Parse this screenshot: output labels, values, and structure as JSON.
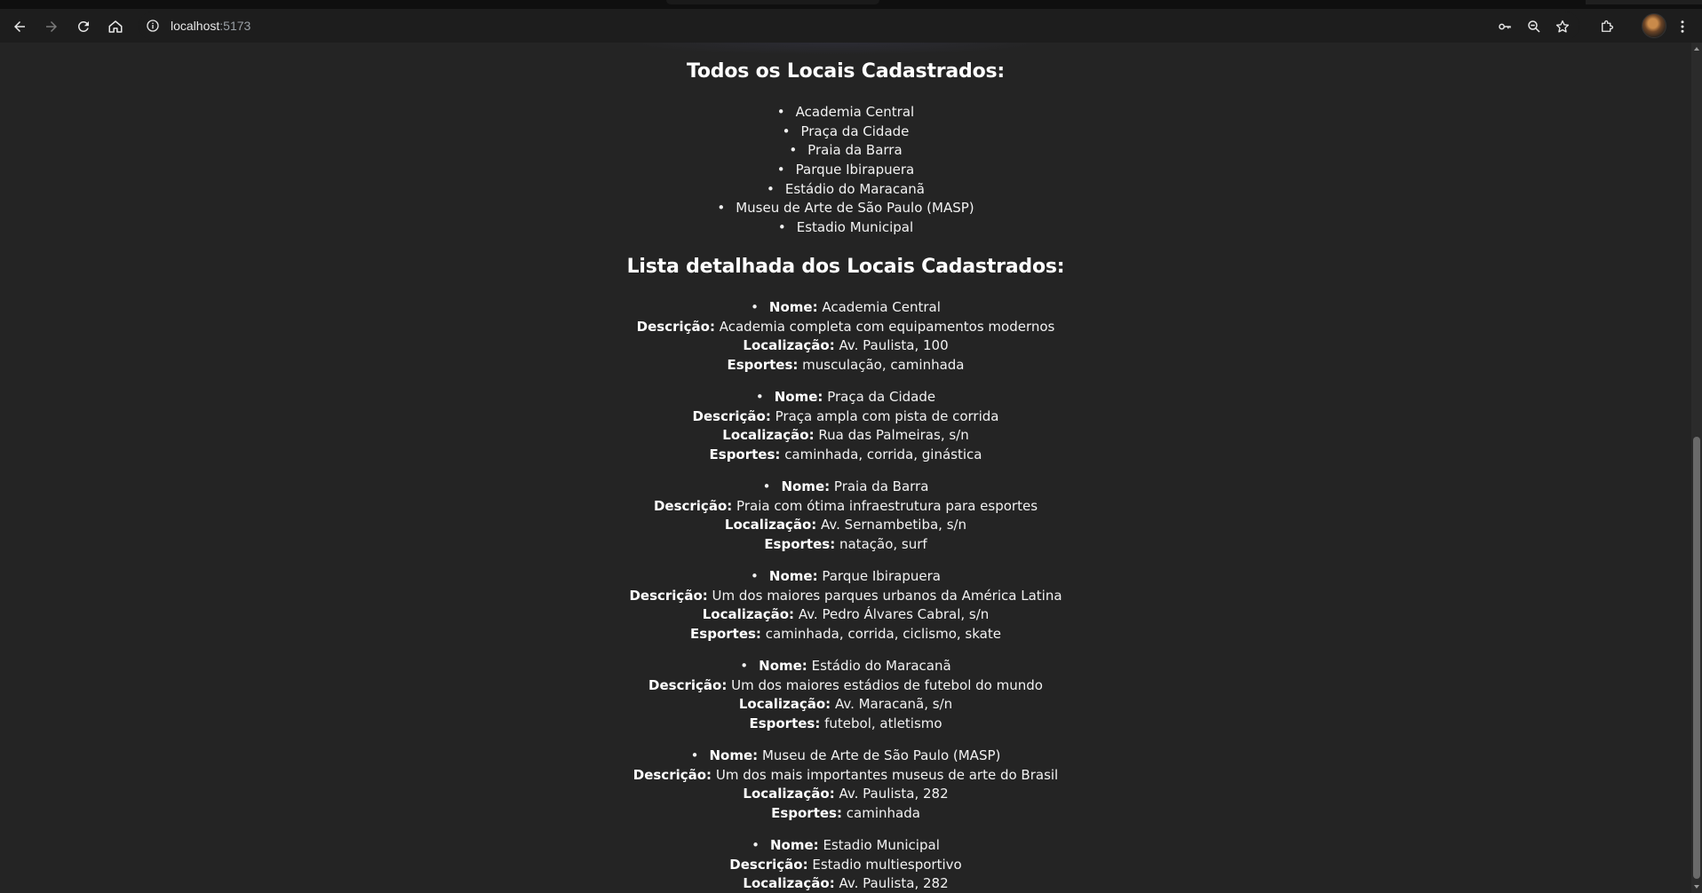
{
  "browser": {
    "url_host": "localhost",
    "url_port": ":5173"
  },
  "page": {
    "all_title": "Todos os Locais Cadastrados:",
    "all_locations": [
      "Academia Central",
      "Praça da Cidade",
      "Praia da Barra",
      "Parque Ibirapuera",
      "Estádio do Maracanã",
      "Museu de Arte de São Paulo (MASP)",
      "Estadio Municipal"
    ],
    "detail_title": "Lista detalhada dos Locais Cadastrados:",
    "labels": {
      "name": "Nome:",
      "description": "Descrição:",
      "location": "Localização:",
      "sports": "Esportes:"
    },
    "details": [
      {
        "name": "Academia Central",
        "description": "Academia completa com equipamentos modernos",
        "location": "Av. Paulista, 100",
        "sports": "musculação, caminhada"
      },
      {
        "name": "Praça da Cidade",
        "description": "Praça ampla com pista de corrida",
        "location": "Rua das Palmeiras, s/n",
        "sports": "caminhada, corrida, ginástica"
      },
      {
        "name": "Praia da Barra",
        "description": "Praia com ótima infraestrutura para esportes",
        "location": "Av. Sernambetiba, s/n",
        "sports": "natação, surf"
      },
      {
        "name": "Parque Ibirapuera",
        "description": "Um dos maiores parques urbanos da América Latina",
        "location": "Av. Pedro Álvares Cabral, s/n",
        "sports": "caminhada, corrida, ciclismo, skate"
      },
      {
        "name": "Estádio do Maracanã",
        "description": "Um dos maiores estádios de futebol do mundo",
        "location": "Av. Maracanã, s/n",
        "sports": "futebol, atletismo"
      },
      {
        "name": "Museu de Arte de São Paulo (MASP)",
        "description": "Um dos mais importantes museus de arte do Brasil",
        "location": "Av. Paulista, 282",
        "sports": "caminhada"
      },
      {
        "name": "Estadio Municipal",
        "description": "Estadio multiesportivo",
        "location": "Av. Paulista, 282"
      }
    ]
  },
  "icons": {
    "back": "arrow-left-icon",
    "forward": "arrow-right-icon",
    "reload": "reload-icon",
    "home": "home-icon",
    "site_info": "info-icon",
    "password": "key-icon",
    "zoom": "zoom-icon",
    "bookmark": "star-icon",
    "extensions": "puzzle-icon",
    "menu": "kebab-menu-icon"
  },
  "colors": {
    "page_background": "#242424",
    "text": "#ffffff",
    "toolbar": "#1d1d1d"
  }
}
